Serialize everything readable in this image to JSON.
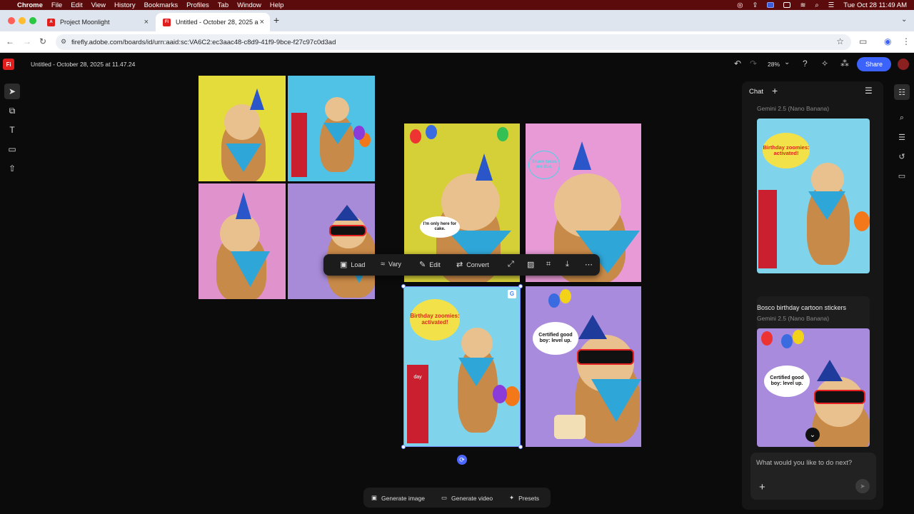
{
  "menubar": {
    "app": "Chrome",
    "items": [
      "File",
      "Edit",
      "View",
      "History",
      "Bookmarks",
      "Profiles",
      "Tab",
      "Window",
      "Help"
    ],
    "clock": "Tue Oct 28  11:49 AM"
  },
  "tabs": [
    {
      "label": "Project Moonlight",
      "favicon": "adobe-icon",
      "color": "#e01e1e"
    },
    {
      "label": "Untitled - October 28, 2025 a",
      "favicon": "firefly-icon",
      "color": "#e01e1e"
    }
  ],
  "address": {
    "url": "firefly.adobe.com/boards/id/urn:aaid:sc:VA6C2:ec3aac48-c8d9-41f9-9bce-f27c97c0d3ad"
  },
  "app": {
    "logo": "Fi",
    "title": "Untitled - October 28, 2025 at 11.47.24",
    "zoom": "28%",
    "share_label": "Share"
  },
  "floating_toolbar": {
    "load": "Load",
    "vary": "Vary",
    "edit": "Edit",
    "convert": "Convert"
  },
  "images": {
    "bubble_cake": "I'm only here for cake.",
    "bubble_snack": "Snack taxes are due.",
    "bubble_zoomies": "Birthday zoomies: activated!",
    "bubble_certified": "Certified good boy: level up.",
    "day_text": "day"
  },
  "bottom_bar": {
    "generate_image": "Generate image",
    "generate_video": "Generate video",
    "presets": "Presets"
  },
  "chat": {
    "header": "Chat",
    "model_label_1": "Gemini 2.5 (Nano Banana)",
    "card2_title": "Bosco birthday cartoon stickers",
    "model_label_2": "Gemini 2.5 (Nano Banana)",
    "input_placeholder": "What would you like to do next?"
  },
  "colors": {
    "accent": "#3b63fb",
    "selection": "#6f8bff",
    "brand": "#e01e1e"
  }
}
